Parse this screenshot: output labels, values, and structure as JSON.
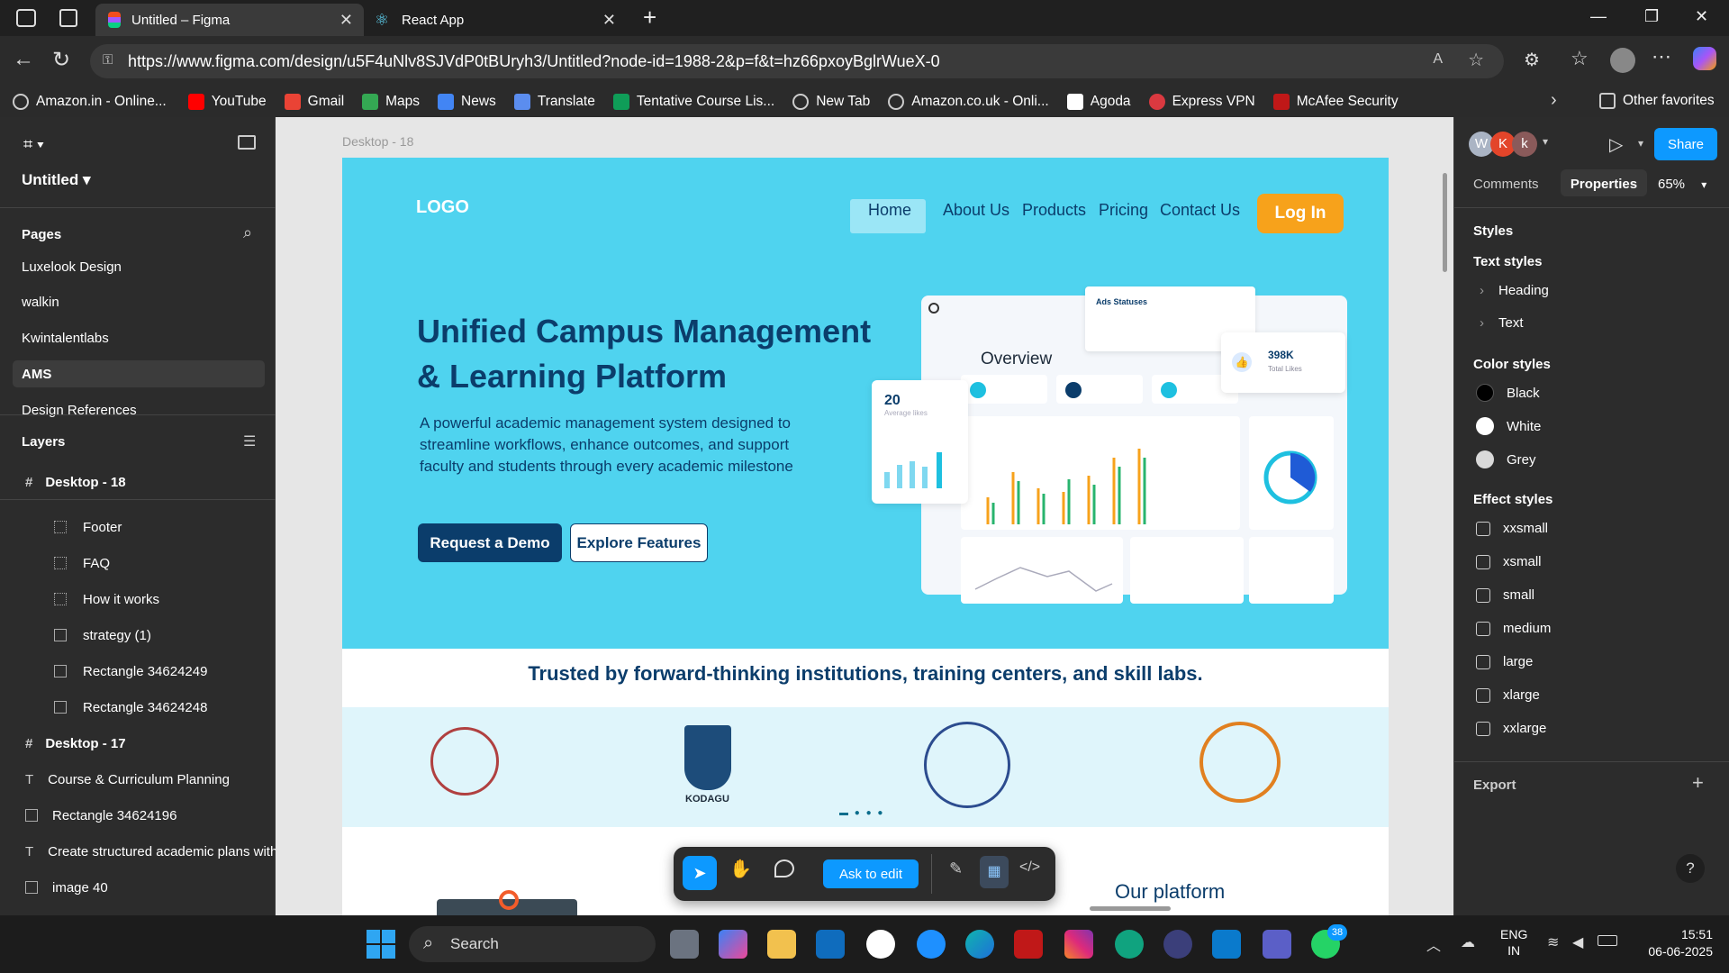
{
  "browser": {
    "tabs": [
      {
        "title": "Untitled – Figma"
      },
      {
        "title": "React App"
      }
    ],
    "url": "https://www.figma.com/design/u5F4uNlv8SJVdP0tBUryh3/Untitled?node-id=1988-2&p=f&t=hz66pxoyBglrWueX-0"
  },
  "bookmarks": [
    "Amazon.in - Online...",
    "YouTube",
    "Gmail",
    "Maps",
    "News",
    "Translate",
    "Tentative Course Lis...",
    "New Tab",
    "Amazon.co.uk - Onli...",
    "Agoda",
    "Express VPN",
    "McAfee Security"
  ],
  "other_favorites": "Other favorites",
  "left": {
    "file": "Untitled",
    "pages_title": "Pages",
    "pages": [
      "Luxelook Design",
      "walkin",
      "Kwintalentlabs",
      "AMS",
      "Design References"
    ],
    "layers_title": "Layers",
    "layers": [
      "Desktop - 18",
      "Footer",
      "FAQ",
      "How it works",
      "strategy (1)",
      "Rectangle 34624249",
      "Rectangle 34624248",
      "Desktop - 17",
      "Course & Curriculum Planning",
      "Rectangle 34624196",
      "Create structured academic plans with",
      "image 40"
    ]
  },
  "canvas": {
    "frame_label": "Desktop - 18",
    "logo": "LOGO",
    "nav": [
      "Home",
      "About Us",
      "Products",
      "Pricing",
      "Contact Us"
    ],
    "login": "Log In",
    "headline1": "Unified Campus Management",
    "headline2": "& Learning Platform",
    "sub": "A powerful academic management system designed to streamline workflows, enhance outcomes, and support faculty and students through every academic milestone",
    "btn_demo": "Request a Demo",
    "btn_explore": "Explore Features",
    "dash": {
      "ads": "Ads Statuses",
      "overview": "Overview",
      "likes": "398K",
      "likes_label": "Total Likes",
      "avg": "20",
      "avg_label": "Average likes"
    },
    "trusted": "Trusted by forward-thinking institutions, training centers, and skill labs.",
    "kodagu": "KODAGU",
    "platform": "Our platform"
  },
  "toolbar": {
    "ask": "Ask to edit"
  },
  "right": {
    "comments": "Comments",
    "properties": "Properties",
    "zoom": "65%",
    "share": "Share",
    "avatars": [
      "W",
      "K",
      "k"
    ],
    "styles": "Styles",
    "text_styles": "Text styles",
    "text_items": [
      "Heading",
      "Text"
    ],
    "color_styles": "Color styles",
    "colors": [
      {
        "name": "Black",
        "hex": "#000000"
      },
      {
        "name": "White",
        "hex": "#ffffff"
      },
      {
        "name": "Grey",
        "hex": "#d9d9d9"
      }
    ],
    "effect_styles": "Effect styles",
    "effects": [
      "xxsmall",
      "xsmall",
      "small",
      "medium",
      "large",
      "xlarge",
      "xxlarge"
    ],
    "export": "Export"
  },
  "taskbar": {
    "search": "Search",
    "lang1": "ENG",
    "lang2": "IN",
    "time": "15:51",
    "date": "06-06-2025",
    "badge": "38"
  }
}
